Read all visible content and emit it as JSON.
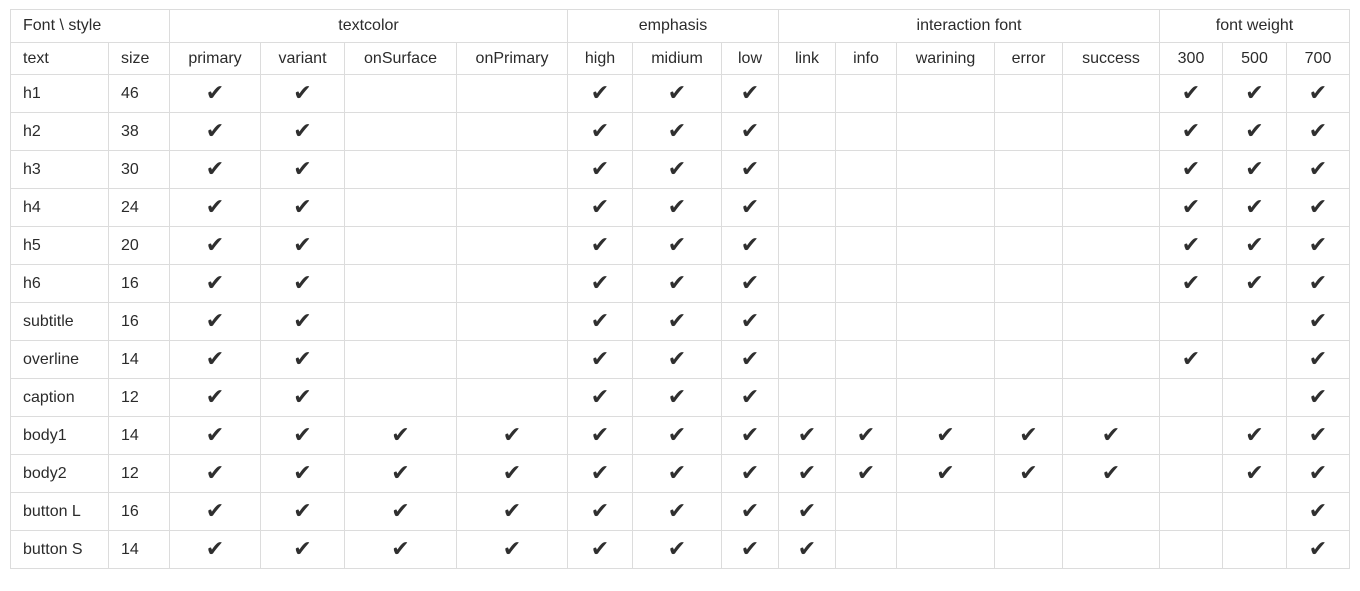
{
  "table": {
    "corner": "Font \\ style",
    "groups": [
      {
        "label": "textcolor",
        "span": 4
      },
      {
        "label": "emphasis",
        "span": 3
      },
      {
        "label": "interaction font",
        "span": 5
      },
      {
        "label": "font weight",
        "span": 3
      }
    ],
    "columns": [
      "text",
      "size",
      "primary",
      "variant",
      "onSurface",
      "onPrimary",
      "high",
      "midium",
      "low",
      "link",
      "info",
      "warining",
      "error",
      "success",
      "300",
      "500",
      "700"
    ],
    "check_glyph": "✔",
    "rows": [
      {
        "text": "h1",
        "size": "46",
        "checks": [
          1,
          1,
          0,
          0,
          1,
          1,
          1,
          0,
          0,
          0,
          0,
          0,
          1,
          1,
          1
        ]
      },
      {
        "text": "h2",
        "size": "38",
        "checks": [
          1,
          1,
          0,
          0,
          1,
          1,
          1,
          0,
          0,
          0,
          0,
          0,
          1,
          1,
          1
        ]
      },
      {
        "text": "h3",
        "size": "30",
        "checks": [
          1,
          1,
          0,
          0,
          1,
          1,
          1,
          0,
          0,
          0,
          0,
          0,
          1,
          1,
          1
        ]
      },
      {
        "text": "h4",
        "size": "24",
        "checks": [
          1,
          1,
          0,
          0,
          1,
          1,
          1,
          0,
          0,
          0,
          0,
          0,
          1,
          1,
          1
        ]
      },
      {
        "text": "h5",
        "size": "20",
        "checks": [
          1,
          1,
          0,
          0,
          1,
          1,
          1,
          0,
          0,
          0,
          0,
          0,
          1,
          1,
          1
        ]
      },
      {
        "text": "h6",
        "size": "16",
        "checks": [
          1,
          1,
          0,
          0,
          1,
          1,
          1,
          0,
          0,
          0,
          0,
          0,
          1,
          1,
          1
        ]
      },
      {
        "text": "subtitle",
        "size": "16",
        "checks": [
          1,
          1,
          0,
          0,
          1,
          1,
          1,
          0,
          0,
          0,
          0,
          0,
          0,
          0,
          1
        ]
      },
      {
        "text": "overline",
        "size": "14",
        "checks": [
          1,
          1,
          0,
          0,
          1,
          1,
          1,
          0,
          0,
          0,
          0,
          0,
          1,
          0,
          1
        ]
      },
      {
        "text": "caption",
        "size": "12",
        "checks": [
          1,
          1,
          0,
          0,
          1,
          1,
          1,
          0,
          0,
          0,
          0,
          0,
          0,
          0,
          1
        ]
      },
      {
        "text": "body1",
        "size": "14",
        "checks": [
          1,
          1,
          1,
          1,
          1,
          1,
          1,
          1,
          1,
          1,
          1,
          1,
          0,
          1,
          1
        ]
      },
      {
        "text": "body2",
        "size": "12",
        "checks": [
          1,
          1,
          1,
          1,
          1,
          1,
          1,
          1,
          1,
          1,
          1,
          1,
          0,
          1,
          1
        ]
      },
      {
        "text": "button L",
        "size": "16",
        "checks": [
          1,
          1,
          1,
          1,
          1,
          1,
          1,
          1,
          0,
          0,
          0,
          0,
          0,
          0,
          1
        ]
      },
      {
        "text": "button S",
        "size": "14",
        "checks": [
          1,
          1,
          1,
          1,
          1,
          1,
          1,
          1,
          0,
          0,
          0,
          0,
          0,
          0,
          1
        ]
      }
    ]
  }
}
